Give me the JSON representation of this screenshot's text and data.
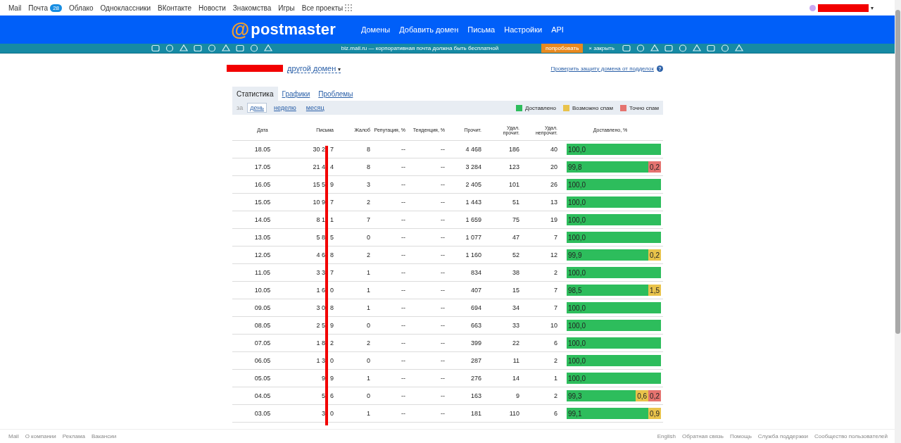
{
  "top_nav": {
    "items": [
      {
        "label": "Mail"
      },
      {
        "label": "Почта",
        "badge": "28"
      },
      {
        "label": "Облако"
      },
      {
        "label": "Одноклассники"
      },
      {
        "label": "ВКонтакте"
      },
      {
        "label": "Новости"
      },
      {
        "label": "Знакомства"
      },
      {
        "label": "Игры"
      },
      {
        "label": "Все проекты",
        "kind": "grid"
      }
    ]
  },
  "header": {
    "logo": {
      "mark": "@",
      "text": "postmaster"
    },
    "nav": [
      "Домены",
      "Добавить домен",
      "Письма",
      "Настройки",
      "API"
    ]
  },
  "banner": {
    "text": "biz.mail.ru — корпоративная почта должна быть бесплатной",
    "button": "попробовать",
    "close_icon": "×",
    "close_label": "закрыть"
  },
  "domain_bar": {
    "switch_label": "другой домен",
    "caret": "▾",
    "check_link": "Проверить защиту домена от подделок",
    "help": "?"
  },
  "tabs": [
    {
      "label": "Статистика",
      "selected": true
    },
    {
      "label": "Графики",
      "selected": false
    },
    {
      "label": "Проблемы",
      "selected": false
    }
  ],
  "period": {
    "label": "за",
    "options": [
      {
        "label": "день",
        "selected": true
      },
      {
        "label": "неделю",
        "selected": false
      },
      {
        "label": "месяц",
        "selected": false
      }
    ]
  },
  "legend": [
    {
      "label": "Доставлено",
      "color": "#2dbd5c"
    },
    {
      "label": "Возможно спам",
      "color": "#e9c34b"
    },
    {
      "label": "Точно спам",
      "color": "#e5736f"
    }
  ],
  "table": {
    "columns": [
      "Дата",
      "Письма",
      "Жалоб",
      "Репутация, %",
      "Тенденция, %",
      "Прочит.",
      "Удал. прочит.",
      "Удал. непрочит.",
      "Доставлено, %"
    ],
    "rows": [
      {
        "date": "18.05",
        "letters_before": "30 2",
        "letters_after": "7",
        "complaints": "8",
        "reputation": "--",
        "trend": "--",
        "read": "4 468",
        "deleted_read": "186",
        "deleted_unread": "40",
        "delivered": [
          {
            "kind": "delivered",
            "value": "100,0"
          }
        ]
      },
      {
        "date": "17.05",
        "letters_before": "21 4",
        "letters_after": "4",
        "complaints": "8",
        "reputation": "--",
        "trend": "--",
        "read": "3 284",
        "deleted_read": "123",
        "deleted_unread": "20",
        "delivered": [
          {
            "kind": "delivered",
            "value": "99,8"
          },
          {
            "kind": "spam",
            "value": "0,2"
          }
        ]
      },
      {
        "date": "16.05",
        "letters_before": "15 5",
        "letters_after": "9",
        "complaints": "3",
        "reputation": "--",
        "trend": "--",
        "read": "2 405",
        "deleted_read": "101",
        "deleted_unread": "26",
        "delivered": [
          {
            "kind": "delivered",
            "value": "100,0"
          }
        ]
      },
      {
        "date": "15.05",
        "letters_before": "10 9",
        "letters_after": "7",
        "complaints": "2",
        "reputation": "--",
        "trend": "--",
        "read": "1 443",
        "deleted_read": "51",
        "deleted_unread": "13",
        "delivered": [
          {
            "kind": "delivered",
            "value": "100,0"
          }
        ]
      },
      {
        "date": "14.05",
        "letters_before": "8 1",
        "letters_after": "1",
        "complaints": "7",
        "reputation": "--",
        "trend": "--",
        "read": "1 659",
        "deleted_read": "75",
        "deleted_unread": "19",
        "delivered": [
          {
            "kind": "delivered",
            "value": "100,0"
          }
        ]
      },
      {
        "date": "13.05",
        "letters_before": "5 8",
        "letters_after": "5",
        "complaints": "0",
        "reputation": "--",
        "trend": "--",
        "read": "1 077",
        "deleted_read": "47",
        "deleted_unread": "7",
        "delivered": [
          {
            "kind": "delivered",
            "value": "100,0"
          }
        ]
      },
      {
        "date": "12.05",
        "letters_before": "4 6",
        "letters_after": "8",
        "complaints": "2",
        "reputation": "--",
        "trend": "--",
        "read": "1 160",
        "deleted_read": "52",
        "deleted_unread": "12",
        "delivered": [
          {
            "kind": "delivered",
            "value": "99,9"
          },
          {
            "kind": "maybe_spam",
            "value": "0,2"
          }
        ]
      },
      {
        "date": "11.05",
        "letters_before": "3 3",
        "letters_after": "7",
        "complaints": "1",
        "reputation": "--",
        "trend": "--",
        "read": "834",
        "deleted_read": "38",
        "deleted_unread": "2",
        "delivered": [
          {
            "kind": "delivered",
            "value": "100,0"
          }
        ]
      },
      {
        "date": "10.05",
        "letters_before": "1 6",
        "letters_after": "0",
        "complaints": "1",
        "reputation": "--",
        "trend": "--",
        "read": "407",
        "deleted_read": "15",
        "deleted_unread": "7",
        "delivered": [
          {
            "kind": "delivered",
            "value": "98,5"
          },
          {
            "kind": "maybe_spam",
            "value": "1,5"
          }
        ]
      },
      {
        "date": "09.05",
        "letters_before": "3 0",
        "letters_after": "8",
        "complaints": "1",
        "reputation": "--",
        "trend": "--",
        "read": "694",
        "deleted_read": "34",
        "deleted_unread": "7",
        "delivered": [
          {
            "kind": "delivered",
            "value": "100,0"
          }
        ]
      },
      {
        "date": "08.05",
        "letters_before": "2 5",
        "letters_after": "9",
        "complaints": "0",
        "reputation": "--",
        "trend": "--",
        "read": "663",
        "deleted_read": "33",
        "deleted_unread": "10",
        "delivered": [
          {
            "kind": "delivered",
            "value": "100,0"
          }
        ]
      },
      {
        "date": "07.05",
        "letters_before": "1 8",
        "letters_after": "2",
        "complaints": "2",
        "reputation": "--",
        "trend": "--",
        "read": "399",
        "deleted_read": "22",
        "deleted_unread": "6",
        "delivered": [
          {
            "kind": "delivered",
            "value": "100,0"
          }
        ]
      },
      {
        "date": "06.05",
        "letters_before": "1 3",
        "letters_after": "0",
        "complaints": "0",
        "reputation": "--",
        "trend": "--",
        "read": "287",
        "deleted_read": "11",
        "deleted_unread": "2",
        "delivered": [
          {
            "kind": "delivered",
            "value": "100,0"
          }
        ]
      },
      {
        "date": "05.05",
        "letters_before": "9",
        "letters_after": "9",
        "complaints": "1",
        "reputation": "--",
        "trend": "--",
        "read": "276",
        "deleted_read": "14",
        "deleted_unread": "1",
        "delivered": [
          {
            "kind": "delivered",
            "value": "100,0"
          }
        ]
      },
      {
        "date": "04.05",
        "letters_before": "5",
        "letters_after": "6",
        "complaints": "0",
        "reputation": "--",
        "trend": "--",
        "read": "163",
        "deleted_read": "9",
        "deleted_unread": "2",
        "delivered": [
          {
            "kind": "delivered",
            "value": "99,3"
          },
          {
            "kind": "maybe_spam",
            "value": "0,6"
          },
          {
            "kind": "spam",
            "value": "0,2"
          }
        ]
      },
      {
        "date": "03.05",
        "letters_before": "3",
        "letters_after": "0",
        "complaints": "1",
        "reputation": "--",
        "trend": "--",
        "read": "181",
        "deleted_read": "110",
        "deleted_unread": "6",
        "delivered": [
          {
            "kind": "delivered",
            "value": "99,1"
          },
          {
            "kind": "maybe_spam",
            "value": "0,9"
          }
        ]
      }
    ]
  },
  "footer": {
    "left": [
      "Mail",
      "О компании",
      "Реклама",
      "Вакансии"
    ],
    "right": [
      "English",
      "Обратная связь",
      "Помощь",
      "Служба поддержки",
      "Сообщество пользователей"
    ]
  }
}
